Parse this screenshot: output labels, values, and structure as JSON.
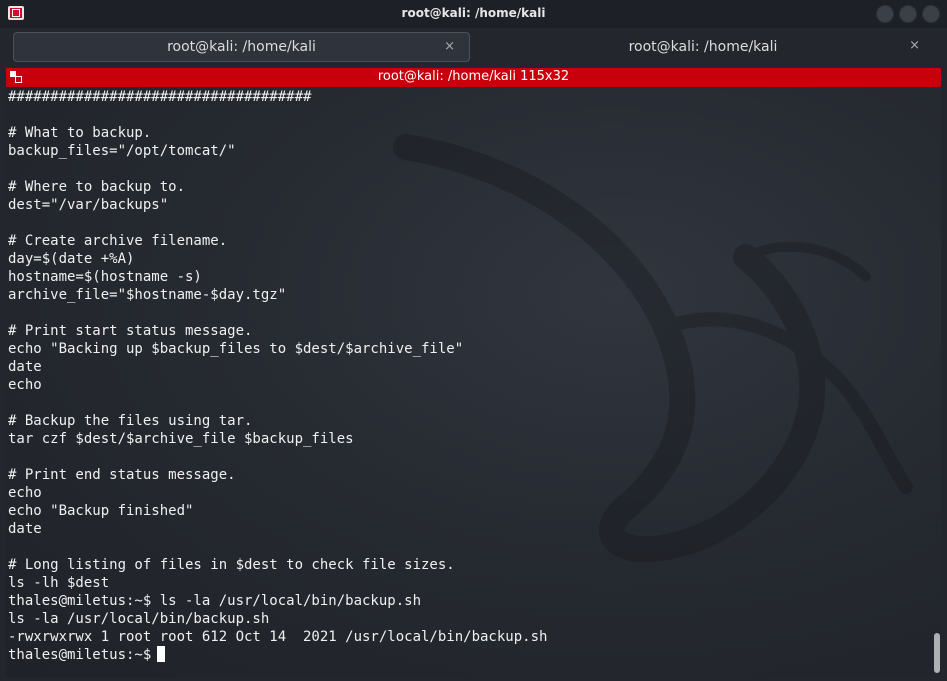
{
  "window": {
    "title": "root@kali: /home/kali"
  },
  "tabs": [
    {
      "label": "root@kali: /home/kali",
      "close": "×",
      "active": true
    },
    {
      "label": "root@kali: /home/kali",
      "close": "×",
      "active": false
    }
  ],
  "terminal": {
    "header": "root@kali: /home/kali 115x32",
    "lines": [
      "####################################",
      "",
      "# What to backup.",
      "backup_files=\"/opt/tomcat/\"",
      "",
      "# Where to backup to.",
      "dest=\"/var/backups\"",
      "",
      "# Create archive filename.",
      "day=$(date +%A)",
      "hostname=$(hostname -s)",
      "archive_file=\"$hostname-$day.tgz\"",
      "",
      "# Print start status message.",
      "echo \"Backing up $backup_files to $dest/$archive_file\"",
      "date",
      "echo",
      "",
      "# Backup the files using tar.",
      "tar czf $dest/$archive_file $backup_files",
      "",
      "# Print end status message.",
      "echo",
      "echo \"Backup finished\"",
      "date",
      "",
      "# Long listing of files in $dest to check file sizes.",
      "ls -lh $dest",
      "thales@miletus:~$ ls -la /usr/local/bin/backup.sh",
      "ls -la /usr/local/bin/backup.sh",
      "-rwxrwxrwx 1 root root 612 Oct 14  2021 /usr/local/bin/backup.sh"
    ],
    "prompt": "thales@miletus:~$"
  },
  "colors": {
    "header_red": "#c8000b",
    "text": "#f0f0f0"
  }
}
